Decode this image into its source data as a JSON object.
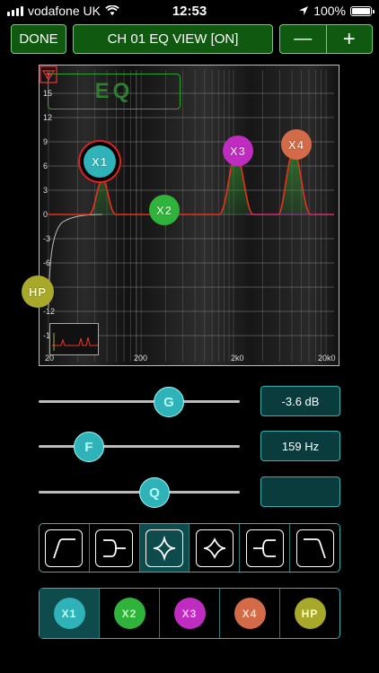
{
  "status": {
    "carrier": "vodafone UK",
    "time": "12:53",
    "battery": "100%"
  },
  "toolbar": {
    "done_label": "DONE",
    "title": "CH 01 EQ VIEW [ON]",
    "minus_label": "—",
    "plus_label": "+"
  },
  "graph": {
    "logo": "EQ",
    "y_ticks": [
      "15",
      "12",
      "9",
      "6",
      "3",
      "0",
      "-3",
      "-6",
      "-9",
      "-12",
      "-15"
    ],
    "x_ticks": [
      "20",
      "200",
      "2k0",
      "20k0"
    ],
    "nodes": [
      {
        "label": "X1",
        "color": "#2fb3b8",
        "selected": true
      },
      {
        "label": "X2",
        "color": "#2fb33a"
      },
      {
        "label": "X3",
        "color": "#c02cc0"
      },
      {
        "label": "X4",
        "color": "#d36a48"
      },
      {
        "label": "HP",
        "color": "#a8a82a"
      }
    ]
  },
  "sliders": [
    {
      "knob": "G",
      "readout": "-3.6 dB",
      "level": 0.65
    },
    {
      "knob": "F",
      "readout": "159 Hz",
      "level": 0.28
    },
    {
      "knob": "Q",
      "readout": "",
      "level": 0.58
    }
  ],
  "filter_types": [
    "low-cut-icon",
    "low-shelf-icon",
    "peak-icon",
    "notch-icon",
    "high-shelf-icon",
    "high-cut-icon"
  ],
  "active_filter_type": 2,
  "bands": [
    {
      "label": "X1",
      "color": "#2fb3b8"
    },
    {
      "label": "X2",
      "color": "#2fb33a"
    },
    {
      "label": "X3",
      "color": "#c02cc0"
    },
    {
      "label": "X4",
      "color": "#d36a48"
    },
    {
      "label": "HP",
      "color": "#a8a82a"
    }
  ],
  "active_band": 0
}
